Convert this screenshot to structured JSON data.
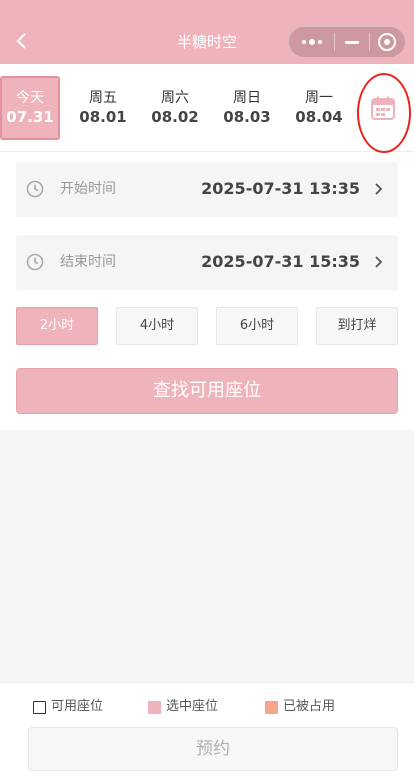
{
  "header": {
    "title": "半糖时空",
    "back_icon": "chevron-left-icon",
    "menu_icon": "more-dots-icon",
    "minimize_icon": "minus-icon",
    "close_icon": "target-icon"
  },
  "dates": [
    {
      "name": "今天",
      "date": "07.31",
      "selected": true
    },
    {
      "name": "周五",
      "date": "08.01",
      "selected": false
    },
    {
      "name": "周六",
      "date": "08.02",
      "selected": false
    },
    {
      "name": "周日",
      "date": "08.03",
      "selected": false
    },
    {
      "name": "周一",
      "date": "08.04",
      "selected": false
    }
  ],
  "calendar_icon": "calendar-icon",
  "start_time": {
    "label": "开始时间",
    "value": "2025-07-31 13:35"
  },
  "end_time": {
    "label": "结束时间",
    "value": "2025-07-31 15:35"
  },
  "durations": [
    {
      "label": "2小时",
      "selected": true
    },
    {
      "label": "4小时",
      "selected": false
    },
    {
      "label": "6小时",
      "selected": false
    },
    {
      "label": "到打烊",
      "selected": false
    }
  ],
  "search_button": "查找可用座位",
  "legend": [
    {
      "label": "可用座位",
      "color": "#ffffff",
      "border": "#333333"
    },
    {
      "label": "选中座位",
      "color": "#eeb3bb",
      "border": "#eeb3bb"
    },
    {
      "label": "已被占用",
      "color": "#f4a58a",
      "border": "#f4a58a"
    }
  ],
  "book_button": "预约",
  "colors": {
    "brand": "#eeb3bb",
    "highlight_circle": "#e8231e"
  }
}
